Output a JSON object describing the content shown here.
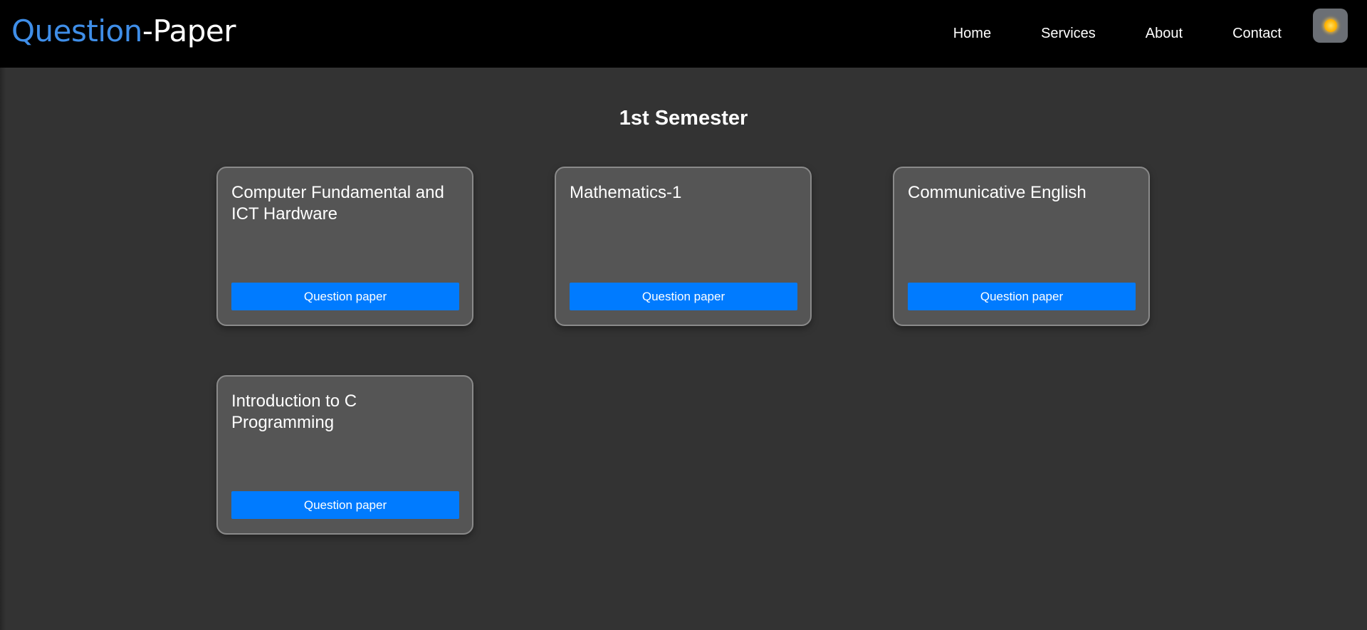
{
  "header": {
    "logo_part1": "Question",
    "logo_part2": "-Paper",
    "nav": [
      "Home",
      "Services",
      "About",
      "Contact"
    ],
    "theme_icon": "sun-icon"
  },
  "main": {
    "title": "1st Semester",
    "cards": [
      {
        "title": "Computer Fundamental and ICT Hardware",
        "button": "Question paper"
      },
      {
        "title": "Mathematics-1",
        "button": "Question paper"
      },
      {
        "title": "Communicative English",
        "button": "Question paper"
      },
      {
        "title": "Introduction to C Programming",
        "button": "Question paper"
      }
    ]
  },
  "colors": {
    "background": "#333333",
    "navbar": "#000000",
    "logo_accent": "#3f8ee8",
    "card": "#555555",
    "button": "#007bff"
  }
}
